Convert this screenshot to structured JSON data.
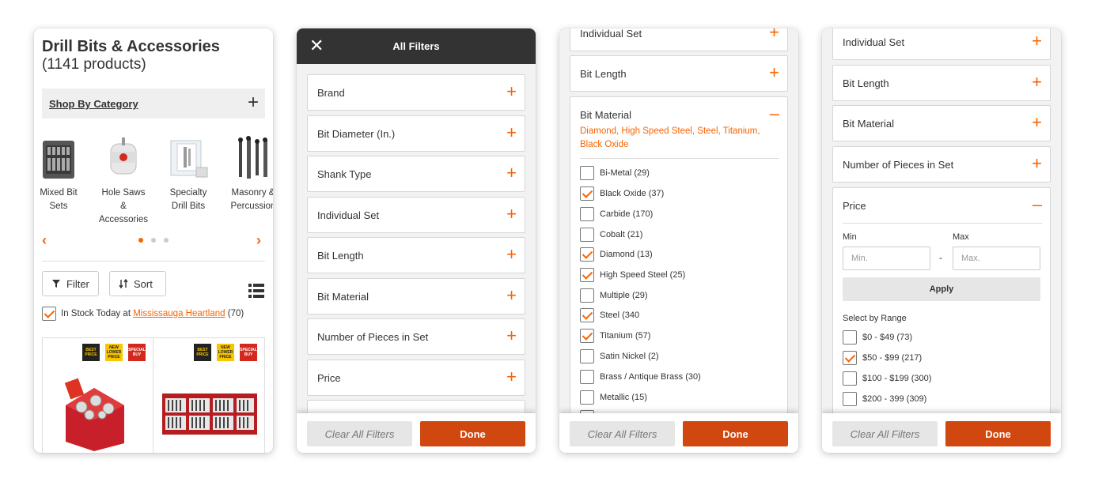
{
  "screen1": {
    "title": "Drill Bits & Accessories",
    "product_count": "(1141 products)",
    "shop_by_category": "Shop By Category",
    "expand_symbol": "+",
    "categories": [
      {
        "label": "Mixed Bit\nSets",
        "icon": "mixed-bit-set-case"
      },
      {
        "label": "Hole Saws\n&\nAccessories",
        "icon": "hole-saw"
      },
      {
        "label": "Specialty\nDrill Bits",
        "icon": "specialty-bit-case"
      },
      {
        "label": "Masonry &\nPercussion",
        "icon": "masonry-bits"
      }
    ],
    "prev_arrow": "‹",
    "next_arrow": "›",
    "filter_label": "Filter",
    "sort_label": "Sort",
    "in_stock_prefix": "In Stock Today at ",
    "store_name": "Mississauga Heartland",
    "store_count": "(70)",
    "in_stock_checked": true,
    "badges": [
      {
        "text": "BEST PRICE",
        "style": "dark"
      },
      {
        "text": "NEW LOWER PRICE",
        "style": "yellow"
      },
      {
        "text": "SPECIAL BUY",
        "style": "red"
      }
    ]
  },
  "screen2": {
    "header_title": "All Filters",
    "close_symbol": "✕",
    "filters": [
      "Brand",
      "Bit Diameter (In.)",
      "Shank Type",
      "Individual Set",
      "Bit Length",
      "Bit Material",
      "Number of Pieces in Set",
      "Price"
    ],
    "plus": "+",
    "clear_label": "Clear All Filters",
    "done_label": "Done"
  },
  "screen3": {
    "rows": [
      "Individual Set",
      "Bit Length"
    ],
    "expanded_title": "Bit Material",
    "selected_text": "Diamond, High Speed Steel, Steel, Titanium, Black Oxide",
    "minus": "–",
    "plus": "+",
    "options": [
      {
        "label": "Bi-Metal (29)",
        "checked": false
      },
      {
        "label": "Black Oxide (37)",
        "checked": true
      },
      {
        "label": "Carbide (170)",
        "checked": false
      },
      {
        "label": "Cobalt (21)",
        "checked": false
      },
      {
        "label": "Diamond (13)",
        "checked": true
      },
      {
        "label": "High Speed Steel (25)",
        "checked": true
      },
      {
        "label": "Multiple (29)",
        "checked": false
      },
      {
        "label": "Steel (340",
        "checked": true
      },
      {
        "label": "Titanium (57)",
        "checked": true
      },
      {
        "label": "Satin Nickel (2)",
        "checked": false
      },
      {
        "label": "Brass / Antique Brass (30)",
        "checked": false
      },
      {
        "label": "Metallic (15)",
        "checked": false
      }
    ],
    "clear_label": "Clear All Filters",
    "done_label": "Done"
  },
  "screen4": {
    "rows": [
      "Individual Set",
      "Bit Length",
      "Bit Material",
      "Number of Pieces in Set"
    ],
    "plus": "+",
    "minus": "–",
    "expanded_title": "Price",
    "min_label": "Min",
    "max_label": "Max",
    "min_placeholder": "Min.",
    "max_placeholder": "Max.",
    "dash": "-",
    "apply_label": "Apply",
    "range_label": "Select by Range",
    "ranges": [
      {
        "label": "$0 - $49 (73)",
        "checked": false
      },
      {
        "label": "$50 - $99 (217)",
        "checked": true
      },
      {
        "label": "$100 - $199 (300)",
        "checked": false
      },
      {
        "label": "$200 - 399 (309)",
        "checked": false
      }
    ],
    "clear_label": "Clear All Filters",
    "done_label": "Done"
  },
  "colors": {
    "accent": "#f96302",
    "done_button": "#d14710",
    "header": "#333333"
  }
}
